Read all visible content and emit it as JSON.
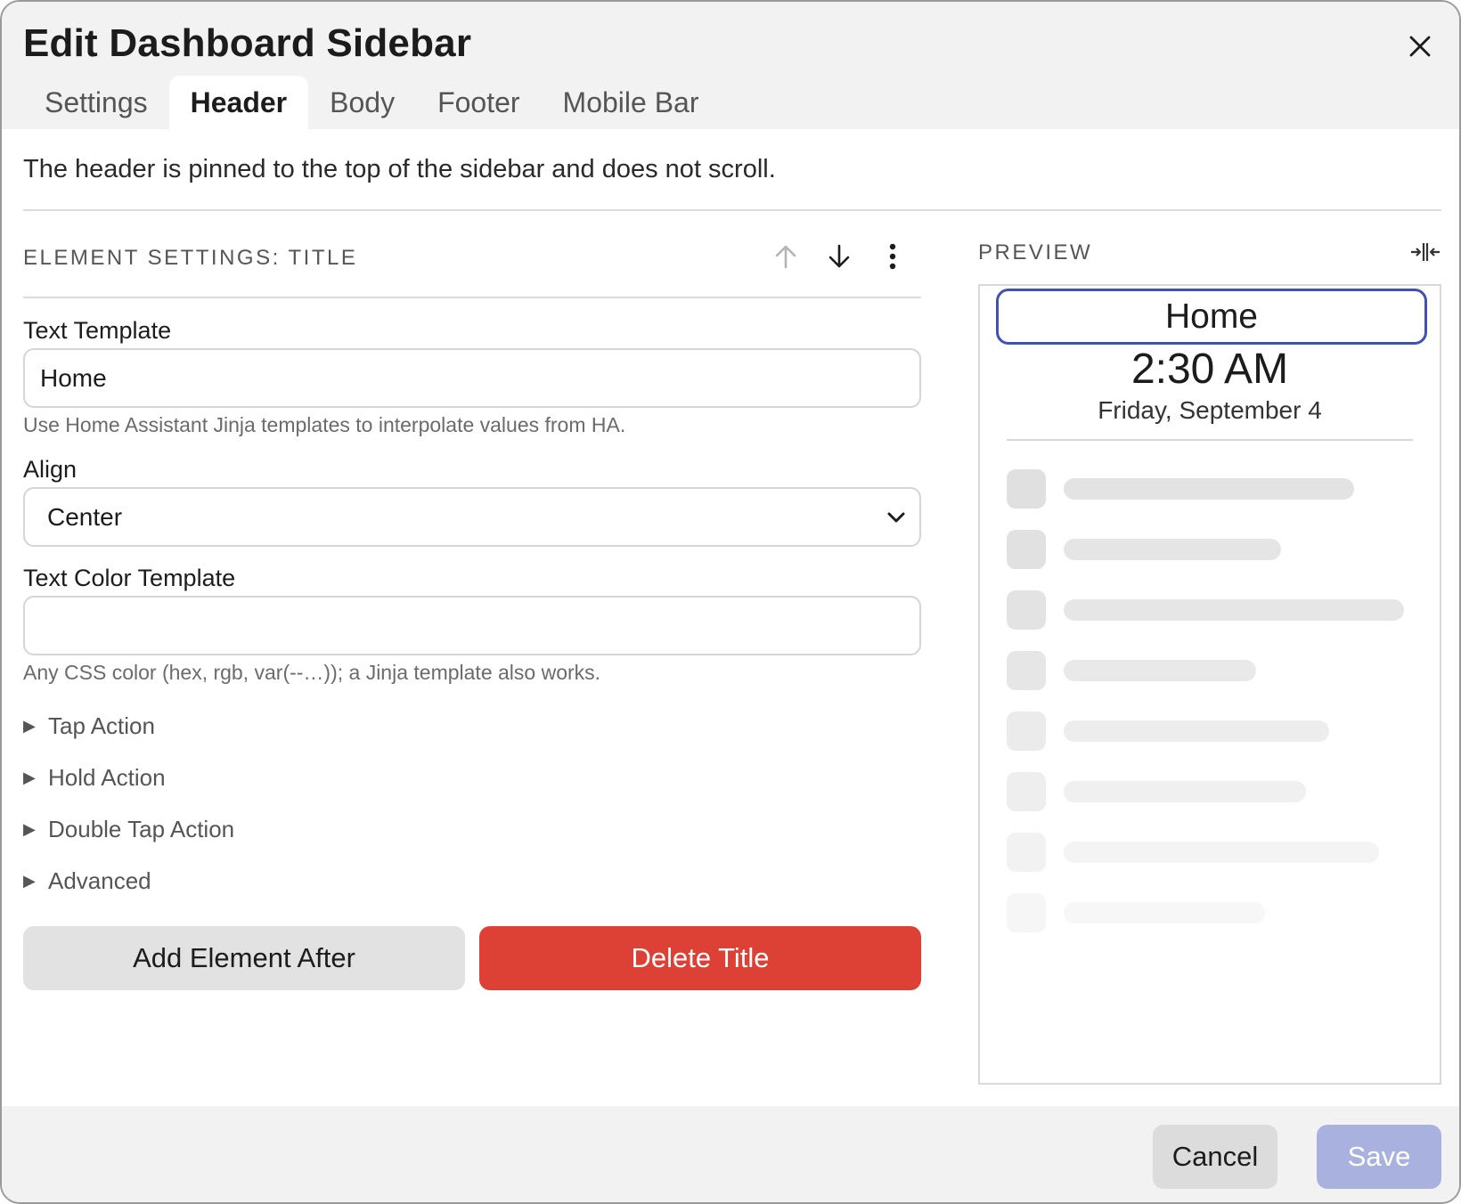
{
  "dialog": {
    "title": "Edit Dashboard Sidebar",
    "close_icon": "close-icon"
  },
  "tabs": [
    {
      "label": "Settings",
      "active": false
    },
    {
      "label": "Header",
      "active": true
    },
    {
      "label": "Body",
      "active": false
    },
    {
      "label": "Footer",
      "active": false
    },
    {
      "label": "Mobile Bar",
      "active": false
    }
  ],
  "intro": "The header is pinned to the top of the sidebar and does not scroll.",
  "element_settings": {
    "heading": "ELEMENT SETTINGS: TITLE",
    "move_up_icon": "arrow-up-icon",
    "move_down_icon": "arrow-down-icon",
    "more_icon": "kebab-menu-icon"
  },
  "fields": {
    "text_template": {
      "label": "Text Template",
      "value": "Home",
      "help": "Use Home Assistant Jinja templates to interpolate values from HA."
    },
    "align": {
      "label": "Align",
      "value": "Center"
    },
    "text_color_template": {
      "label": "Text Color Template",
      "value": "",
      "help": "Any CSS color (hex, rgb, var(--…)); a Jinja template also works."
    }
  },
  "disclosures": [
    {
      "label": "Tap Action"
    },
    {
      "label": "Hold Action"
    },
    {
      "label": "Double Tap Action"
    },
    {
      "label": "Advanced"
    }
  ],
  "actions": {
    "add_after": "Add Element After",
    "delete": "Delete Title"
  },
  "preview": {
    "label": "PREVIEW",
    "toggle_icon": "collapse-horizontal-icon",
    "title": "Home",
    "time": "2:30 AM",
    "date": "Friday, September 4",
    "skeleton_rows": 8
  },
  "footer": {
    "cancel": "Cancel",
    "save": "Save"
  },
  "colors": {
    "accent": "#3f51b5",
    "danger": "#dd4136",
    "save_disabled": "#a9b2df"
  }
}
